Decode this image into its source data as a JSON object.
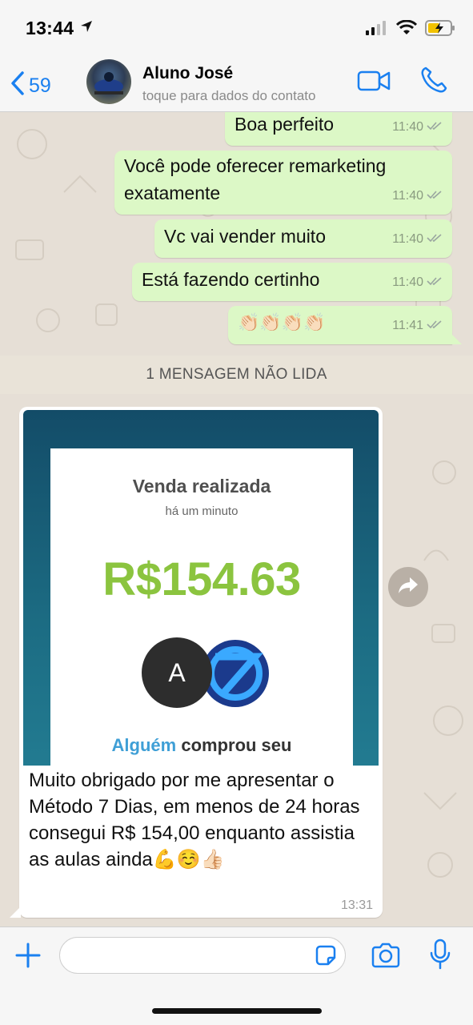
{
  "status_bar": {
    "time": "13:44"
  },
  "header": {
    "back_count": "59",
    "contact_name": "Aluno José",
    "contact_subtitle": "toque para dados do contato"
  },
  "messages_out": [
    {
      "text": "Boa perfeito",
      "time": "11:40"
    },
    {
      "text": "Você pode oferecer remarketing exatamente",
      "time": "11:40"
    },
    {
      "text": "Vc vai vender muito",
      "time": "11:40"
    },
    {
      "text": "Está fazendo certinho",
      "time": "11:40"
    },
    {
      "text": "👏🏻👏🏻👏🏻👏🏻",
      "time": "11:41"
    }
  ],
  "unread_banner": "1 MENSAGEM NÃO LIDA",
  "incoming": {
    "image": {
      "title": "Venda realizada",
      "time_ago": "há um minuto",
      "amount": "R$154.63",
      "avatar_letter": "A",
      "line_highlight": "Alguém",
      "line_rest": "comprou seu"
    },
    "caption": "Muito obrigado por me apresentar o Método 7 Dias, em menos de 24 horas consegui R$ 154,00 enquanto assistia as aulas ainda💪☺️👍🏻",
    "time": "13:31"
  },
  "colors": {
    "accent": "#1a80f0",
    "outgoing_bubble": "#dcf8c6",
    "chat_bg": "#e6dfd6",
    "sale_green": "#8bc43f"
  },
  "icons": [
    "location-arrow-icon",
    "signal-icon",
    "wifi-icon",
    "battery-charging-icon",
    "back-chevron-icon",
    "video-call-icon",
    "phone-icon",
    "double-check-icon",
    "forward-icon",
    "plus-icon",
    "sticker-icon",
    "camera-icon",
    "microphone-icon"
  ]
}
